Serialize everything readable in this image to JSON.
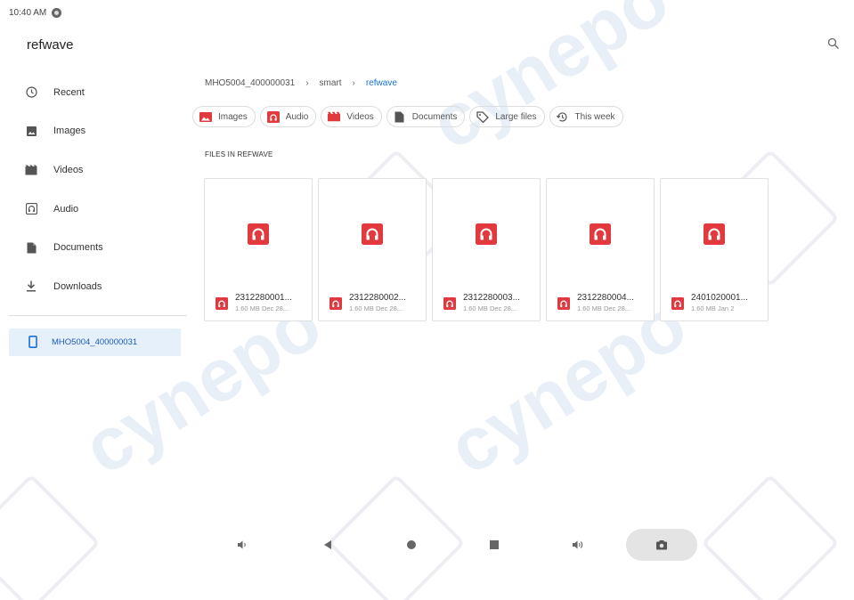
{
  "status": {
    "time": "10:40 AM"
  },
  "app": {
    "title": "refwave"
  },
  "sidebar": {
    "items": [
      {
        "label": "Recent",
        "icon": "clock-icon"
      },
      {
        "label": "Images",
        "icon": "image-icon"
      },
      {
        "label": "Videos",
        "icon": "video-icon"
      },
      {
        "label": "Audio",
        "icon": "audio-icon"
      },
      {
        "label": "Documents",
        "icon": "document-icon"
      },
      {
        "label": "Downloads",
        "icon": "download-icon"
      }
    ],
    "device": {
      "label": "MHO5004_400000031",
      "icon": "phone-icon"
    }
  },
  "breadcrumb": [
    "MHO5004_400000031",
    "smart",
    "refwave"
  ],
  "chips": [
    {
      "label": "Images",
      "icon": "image-icon"
    },
    {
      "label": "Audio",
      "icon": "audio-icon"
    },
    {
      "label": "Videos",
      "icon": "video-icon"
    },
    {
      "label": "Documents",
      "icon": "document-icon"
    },
    {
      "label": "Large files",
      "icon": "tag-icon"
    },
    {
      "label": "This week",
      "icon": "history-icon"
    }
  ],
  "section": {
    "title": "FILES IN REFWAVE"
  },
  "files": [
    {
      "name": "2312280001...",
      "meta": "1.60 MB Dec 28..."
    },
    {
      "name": "2312280002...",
      "meta": "1.60 MB Dec 28..."
    },
    {
      "name": "2312280003...",
      "meta": "1.60 MB Dec 28..."
    },
    {
      "name": "2312280004...",
      "meta": "1.60 MB Dec 28..."
    },
    {
      "name": "2401020001...",
      "meta": "1.60 MB Jan 2"
    }
  ],
  "colors": {
    "accent": "#1a6fd6",
    "audio_red": "#e0393e",
    "device_bg": "#e6f0fb"
  },
  "watermark": {
    "text": "cynepo"
  },
  "navbar": {
    "icons": [
      "volume-down-icon",
      "back-icon",
      "home-icon",
      "recents-icon",
      "volume-up-icon",
      "screenshot-icon"
    ]
  }
}
